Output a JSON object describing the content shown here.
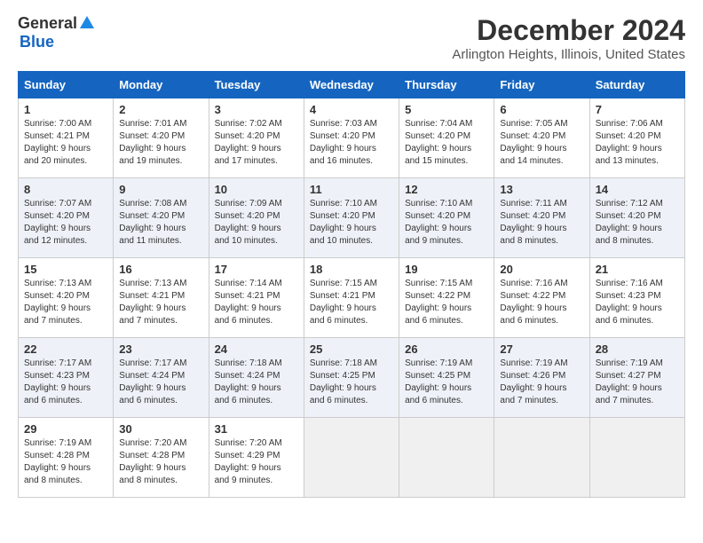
{
  "header": {
    "logo_general": "General",
    "logo_blue": "Blue",
    "main_title": "December 2024",
    "subtitle": "Arlington Heights, Illinois, United States"
  },
  "calendar": {
    "days_of_week": [
      "Sunday",
      "Monday",
      "Tuesday",
      "Wednesday",
      "Thursday",
      "Friday",
      "Saturday"
    ],
    "weeks": [
      [
        {
          "day": "1",
          "sunrise": "7:00 AM",
          "sunset": "4:21 PM",
          "daylight": "9 hours and 20 minutes."
        },
        {
          "day": "2",
          "sunrise": "7:01 AM",
          "sunset": "4:20 PM",
          "daylight": "9 hours and 19 minutes."
        },
        {
          "day": "3",
          "sunrise": "7:02 AM",
          "sunset": "4:20 PM",
          "daylight": "9 hours and 17 minutes."
        },
        {
          "day": "4",
          "sunrise": "7:03 AM",
          "sunset": "4:20 PM",
          "daylight": "9 hours and 16 minutes."
        },
        {
          "day": "5",
          "sunrise": "7:04 AM",
          "sunset": "4:20 PM",
          "daylight": "9 hours and 15 minutes."
        },
        {
          "day": "6",
          "sunrise": "7:05 AM",
          "sunset": "4:20 PM",
          "daylight": "9 hours and 14 minutes."
        },
        {
          "day": "7",
          "sunrise": "7:06 AM",
          "sunset": "4:20 PM",
          "daylight": "9 hours and 13 minutes."
        }
      ],
      [
        {
          "day": "8",
          "sunrise": "7:07 AM",
          "sunset": "4:20 PM",
          "daylight": "9 hours and 12 minutes."
        },
        {
          "day": "9",
          "sunrise": "7:08 AM",
          "sunset": "4:20 PM",
          "daylight": "9 hours and 11 minutes."
        },
        {
          "day": "10",
          "sunrise": "7:09 AM",
          "sunset": "4:20 PM",
          "daylight": "9 hours and 10 minutes."
        },
        {
          "day": "11",
          "sunrise": "7:10 AM",
          "sunset": "4:20 PM",
          "daylight": "9 hours and 10 minutes."
        },
        {
          "day": "12",
          "sunrise": "7:10 AM",
          "sunset": "4:20 PM",
          "daylight": "9 hours and 9 minutes."
        },
        {
          "day": "13",
          "sunrise": "7:11 AM",
          "sunset": "4:20 PM",
          "daylight": "9 hours and 8 minutes."
        },
        {
          "day": "14",
          "sunrise": "7:12 AM",
          "sunset": "4:20 PM",
          "daylight": "9 hours and 8 minutes."
        }
      ],
      [
        {
          "day": "15",
          "sunrise": "7:13 AM",
          "sunset": "4:20 PM",
          "daylight": "9 hours and 7 minutes."
        },
        {
          "day": "16",
          "sunrise": "7:13 AM",
          "sunset": "4:21 PM",
          "daylight": "9 hours and 7 minutes."
        },
        {
          "day": "17",
          "sunrise": "7:14 AM",
          "sunset": "4:21 PM",
          "daylight": "9 hours and 6 minutes."
        },
        {
          "day": "18",
          "sunrise": "7:15 AM",
          "sunset": "4:21 PM",
          "daylight": "9 hours and 6 minutes."
        },
        {
          "day": "19",
          "sunrise": "7:15 AM",
          "sunset": "4:22 PM",
          "daylight": "9 hours and 6 minutes."
        },
        {
          "day": "20",
          "sunrise": "7:16 AM",
          "sunset": "4:22 PM",
          "daylight": "9 hours and 6 minutes."
        },
        {
          "day": "21",
          "sunrise": "7:16 AM",
          "sunset": "4:23 PM",
          "daylight": "9 hours and 6 minutes."
        }
      ],
      [
        {
          "day": "22",
          "sunrise": "7:17 AM",
          "sunset": "4:23 PM",
          "daylight": "9 hours and 6 minutes."
        },
        {
          "day": "23",
          "sunrise": "7:17 AM",
          "sunset": "4:24 PM",
          "daylight": "9 hours and 6 minutes."
        },
        {
          "day": "24",
          "sunrise": "7:18 AM",
          "sunset": "4:24 PM",
          "daylight": "9 hours and 6 minutes."
        },
        {
          "day": "25",
          "sunrise": "7:18 AM",
          "sunset": "4:25 PM",
          "daylight": "9 hours and 6 minutes."
        },
        {
          "day": "26",
          "sunrise": "7:19 AM",
          "sunset": "4:25 PM",
          "daylight": "9 hours and 6 minutes."
        },
        {
          "day": "27",
          "sunrise": "7:19 AM",
          "sunset": "4:26 PM",
          "daylight": "9 hours and 7 minutes."
        },
        {
          "day": "28",
          "sunrise": "7:19 AM",
          "sunset": "4:27 PM",
          "daylight": "9 hours and 7 minutes."
        }
      ],
      [
        {
          "day": "29",
          "sunrise": "7:19 AM",
          "sunset": "4:28 PM",
          "daylight": "9 hours and 8 minutes."
        },
        {
          "day": "30",
          "sunrise": "7:20 AM",
          "sunset": "4:28 PM",
          "daylight": "9 hours and 8 minutes."
        },
        {
          "day": "31",
          "sunrise": "7:20 AM",
          "sunset": "4:29 PM",
          "daylight": "9 hours and 9 minutes."
        },
        null,
        null,
        null,
        null
      ]
    ]
  }
}
